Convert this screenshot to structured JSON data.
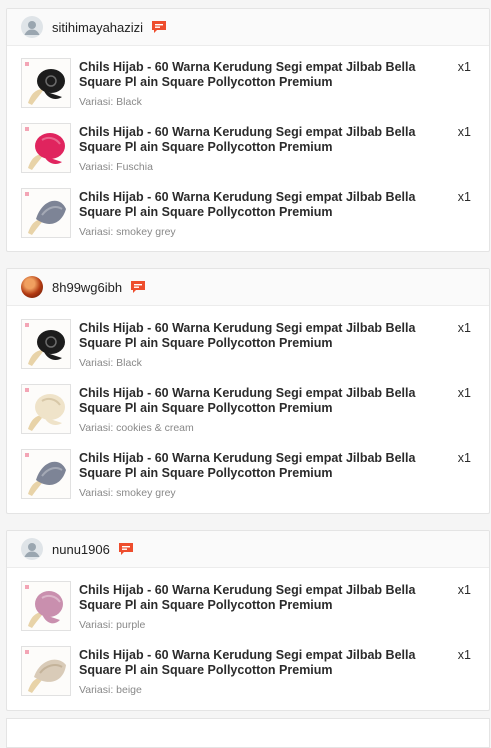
{
  "orders": [
    {
      "username": "sitihimayahazizi",
      "items": [
        {
          "title": "Chils Hijab - 60 Warna Kerudung Segi empat Jilbab Bella Square Pl ain Square Pollycotton Premium",
          "qty": "x1",
          "variant": "Variasi: Black",
          "color": "#1c1c1c"
        },
        {
          "title": "Chils Hijab - 60 Warna Kerudung Segi empat Jilbab Bella Square Pl ain Square Pollycotton Premium",
          "qty": "x1",
          "variant": "Variasi: Fuschia",
          "color": "#e0245e"
        },
        {
          "title": "Chils Hijab - 60 Warna Kerudung Segi empat Jilbab Bella Square Pl ain Square Pollycotton Premium",
          "qty": "x1",
          "variant": "Variasi: smokey grey",
          "color": "#7d8496"
        }
      ]
    },
    {
      "username": "8h99wg6ibh",
      "items": [
        {
          "title": "Chils Hijab - 60 Warna Kerudung Segi empat Jilbab Bella Square Pl ain Square Pollycotton Premium",
          "qty": "x1",
          "variant": "Variasi: Black",
          "color": "#1c1c1c"
        },
        {
          "title": "Chils Hijab - 60 Warna Kerudung Segi empat Jilbab Bella Square Pl ain Square Pollycotton Premium",
          "qty": "x1",
          "variant": "Variasi: cookies & cream",
          "color": "#efe3c9"
        },
        {
          "title": "Chils Hijab - 60 Warna Kerudung Segi empat Jilbab Bella Square Pl ain Square Pollycotton Premium",
          "qty": "x1",
          "variant": "Variasi: smokey grey",
          "color": "#7d8496"
        }
      ]
    },
    {
      "username": "nunu1906",
      "items": [
        {
          "title": "Chils Hijab - 60 Warna Kerudung Segi empat Jilbab Bella Square Pl ain Square Pollycotton Premium",
          "qty": "x1",
          "variant": "Variasi: purple",
          "color": "#c98fae"
        },
        {
          "title": "Chils Hijab - 60 Warna Kerudung Segi empat Jilbab Bella Square Pl ain Square Pollycotton Premium",
          "qty": "x1",
          "variant": "Variasi: beige",
          "color": "#d9cbb8"
        }
      ]
    }
  ],
  "icons": {
    "chat": "chat-icon",
    "avatar_default": "user-avatar-icon",
    "avatar_photo": "user-photo-avatar"
  },
  "colors": {
    "accent": "#ee4d2d",
    "accessory": "#e8d3a8"
  }
}
